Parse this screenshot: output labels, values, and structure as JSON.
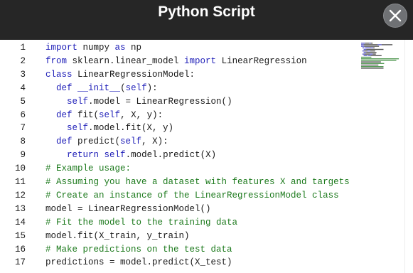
{
  "window": {
    "title": "Python Script",
    "close_icon": "close-icon",
    "accent_bg": "#262626",
    "close_bg": "#6f7174"
  },
  "editor": {
    "language": "python",
    "lines": [
      {
        "number": "1",
        "tokens": [
          {
            "t": "import",
            "c": "kw"
          },
          {
            "t": " numpy ",
            "c": "pl"
          },
          {
            "t": "as",
            "c": "kw"
          },
          {
            "t": " np",
            "c": "pl"
          }
        ]
      },
      {
        "number": "2",
        "tokens": [
          {
            "t": "from",
            "c": "kw"
          },
          {
            "t": " sklearn.linear_model ",
            "c": "pl"
          },
          {
            "t": "import",
            "c": "kw"
          },
          {
            "t": " LinearRegression",
            "c": "pl"
          }
        ]
      },
      {
        "number": "3",
        "tokens": [
          {
            "t": "class",
            "c": "kw"
          },
          {
            "t": " LinearRegressionModel:",
            "c": "pl"
          }
        ]
      },
      {
        "number": "4",
        "tokens": [
          {
            "t": "  ",
            "c": "pl"
          },
          {
            "t": "def",
            "c": "kw"
          },
          {
            "t": " ",
            "c": "pl"
          },
          {
            "t": "__init__",
            "c": "kw"
          },
          {
            "t": "(",
            "c": "pl"
          },
          {
            "t": "self",
            "c": "kw"
          },
          {
            "t": "):",
            "c": "pl"
          }
        ]
      },
      {
        "number": "5",
        "tokens": [
          {
            "t": "    ",
            "c": "pl"
          },
          {
            "t": "self",
            "c": "kw"
          },
          {
            "t": ".model = LinearRegression()",
            "c": "pl"
          }
        ]
      },
      {
        "number": "6",
        "tokens": [
          {
            "t": "  ",
            "c": "pl"
          },
          {
            "t": "def",
            "c": "kw"
          },
          {
            "t": " fit(",
            "c": "pl"
          },
          {
            "t": "self",
            "c": "kw"
          },
          {
            "t": ", X, y):",
            "c": "pl"
          }
        ]
      },
      {
        "number": "7",
        "tokens": [
          {
            "t": "    ",
            "c": "pl"
          },
          {
            "t": "self",
            "c": "kw"
          },
          {
            "t": ".model.fit(X, y)",
            "c": "pl"
          }
        ]
      },
      {
        "number": "8",
        "tokens": [
          {
            "t": "  ",
            "c": "pl"
          },
          {
            "t": "def",
            "c": "kw"
          },
          {
            "t": " predict(",
            "c": "pl"
          },
          {
            "t": "self",
            "c": "kw"
          },
          {
            "t": ", X):",
            "c": "pl"
          }
        ]
      },
      {
        "number": "9",
        "tokens": [
          {
            "t": "    ",
            "c": "pl"
          },
          {
            "t": "return",
            "c": "kw"
          },
          {
            "t": " ",
            "c": "pl"
          },
          {
            "t": "self",
            "c": "kw"
          },
          {
            "t": ".model.predict(X)",
            "c": "pl"
          }
        ]
      },
      {
        "number": "10",
        "tokens": [
          {
            "t": "# Example usage:",
            "c": "cm"
          }
        ]
      },
      {
        "number": "11",
        "tokens": [
          {
            "t": "# Assuming you have a dataset with features X and targets y",
            "c": "cm"
          }
        ]
      },
      {
        "number": "12",
        "tokens": [
          {
            "t": "# Create an instance of the LinearRegressionModel class",
            "c": "cm"
          }
        ]
      },
      {
        "number": "13",
        "tokens": [
          {
            "t": "model = LinearRegressionModel()",
            "c": "pl"
          }
        ]
      },
      {
        "number": "14",
        "tokens": [
          {
            "t": "# Fit the model to the training data",
            "c": "cm"
          }
        ]
      },
      {
        "number": "15",
        "tokens": [
          {
            "t": "model.fit(X_train, y_train)",
            "c": "pl"
          }
        ]
      },
      {
        "number": "16",
        "tokens": [
          {
            "t": "# Make predictions on the test data",
            "c": "cm"
          }
        ]
      },
      {
        "number": "17",
        "tokens": [
          {
            "t": "predictions = model.predict(X_test)",
            "c": "pl"
          }
        ]
      }
    ],
    "colors": {
      "keyword": "#1f1fb8",
      "comment": "#1d7a1d",
      "plain": "#1a1a1a"
    }
  }
}
